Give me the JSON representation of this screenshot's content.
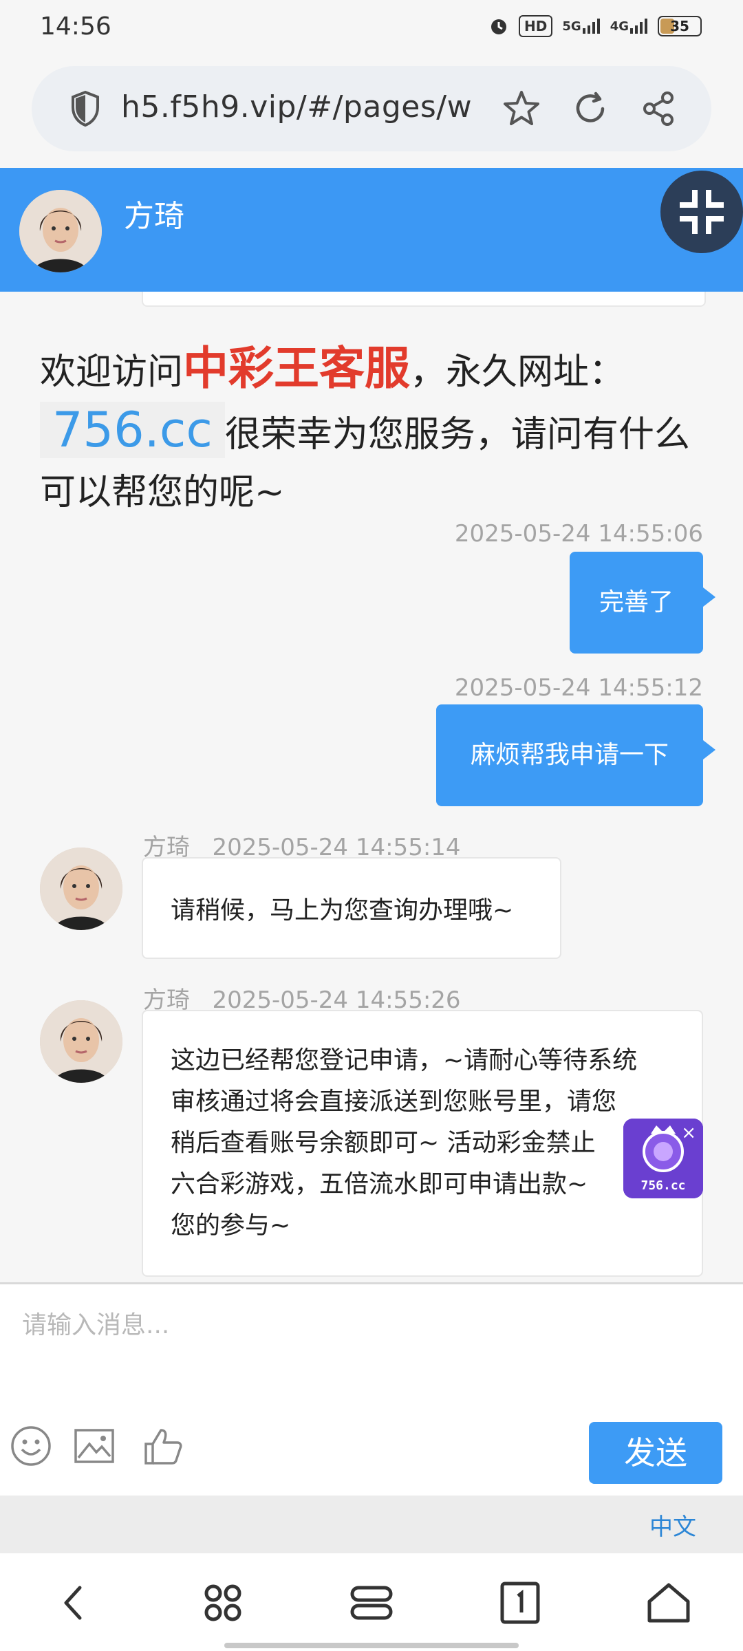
{
  "status_bar": {
    "time": "14:56",
    "hd_label": "HD",
    "net_5g": "5G",
    "net_4g": "4G",
    "battery_level": 35
  },
  "browser": {
    "url": "h5.f5h9.vip/#/pages/w"
  },
  "header": {
    "agent_name": "方琦"
  },
  "welcome": {
    "prefix": "欢迎访问",
    "brand": "中彩王客服",
    "middle": "，永久网址：",
    "domain": "756.cc",
    "suffix": "很荣幸为您服务，请问有什么可以帮您的呢~"
  },
  "messages": [
    {
      "dir": "out",
      "time": "2025-05-24 14:55:06",
      "text": "完善了"
    },
    {
      "dir": "out",
      "time": "2025-05-24 14:55:12",
      "text": "麻烦帮我申请一下"
    },
    {
      "dir": "in",
      "sender": "方琦",
      "time": "2025-05-24 14:55:14",
      "text": "请稍候，马上为您查询办理哦~"
    },
    {
      "dir": "in",
      "sender": "方琦",
      "time": "2025-05-24 14:55:26",
      "lines": [
        "这边已经帮您登记申请，~请耐心等待系统",
        "审核通过将会直接派送到您账号里，请您",
        "稍后查看账号余额即可~ 活动彩金禁止",
        "六合彩游戏，五倍流水即可申请出款~",
        "您的参与~"
      ]
    }
  ],
  "floating_badge": {
    "label": "756.cc",
    "close": "×"
  },
  "composer": {
    "placeholder": "请输入消息...",
    "send_label": "发送",
    "language": "中文"
  },
  "colors": {
    "primary": "#3c98f4",
    "brand_red": "#e23b2c",
    "domain_blue": "#3c9ae8",
    "fullscreen_bg": "#2c3e58"
  }
}
